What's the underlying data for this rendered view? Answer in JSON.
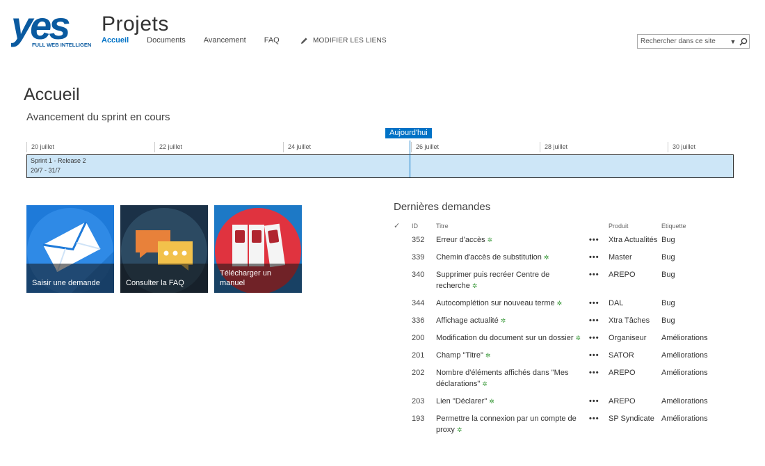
{
  "brand": {
    "logo_text": "yes",
    "logo_tagline": "FULL WEB INTELLIGENCE",
    "color": "#0a5aa0"
  },
  "site_title": "Projets",
  "nav": [
    {
      "label": "Accueil",
      "active": true
    },
    {
      "label": "Documents"
    },
    {
      "label": "Avancement"
    },
    {
      "label": "FAQ"
    }
  ],
  "edit_links": {
    "label": "MODIFIER LES LIENS",
    "icon": "pencil-icon"
  },
  "search": {
    "placeholder": "Rechercher dans ce site",
    "icon": "search-icon"
  },
  "page_title": "Accueil",
  "sprint": {
    "title": "Avancement du sprint en cours",
    "today_label": "Aujourd'hui",
    "dates": [
      "20 juillet",
      "22 juillet",
      "24 juillet",
      "26 juillet",
      "28 juillet",
      "30 juillet"
    ],
    "bar_name": "Sprint 1 - Release 2",
    "bar_range": "20/7 - 31/7"
  },
  "tiles": [
    {
      "label": "Saisir une demande",
      "icon": "envelope-icon",
      "color": "#1e7ad9"
    },
    {
      "label": "Consulter la FAQ",
      "icon": "chat-icon",
      "color": "#2c4a62"
    },
    {
      "label": "Télécharger un manuel",
      "icon": "binders-icon",
      "color": "#e0333f"
    }
  ],
  "requests": {
    "title": "Dernières demandes",
    "columns": {
      "check": "✓",
      "id": "ID",
      "title": "Titre",
      "product": "Produit",
      "tag": "Etiquette"
    },
    "rows": [
      {
        "id": "352",
        "title": "Erreur d'accès",
        "product": "Xtra Actualités",
        "tag": "Bug"
      },
      {
        "id": "339",
        "title": "Chemin d'accès de substitution",
        "product": "Master",
        "tag": "Bug"
      },
      {
        "id": "340",
        "title": "Supprimer puis recréer Centre de recherche",
        "product": "AREPO",
        "tag": "Bug"
      },
      {
        "id": "344",
        "title": "Autocomplétion sur nouveau terme",
        "product": "DAL",
        "tag": "Bug"
      },
      {
        "id": "336",
        "title": "Affichage actualité",
        "product": "Xtra Tâches",
        "tag": "Bug"
      },
      {
        "id": "200",
        "title": "Modification du document sur un dossier",
        "product": "Organiseur",
        "tag": "Améliorations"
      },
      {
        "id": "201",
        "title": "Champ \"Titre\"",
        "product": "SATOR",
        "tag": "Améliorations"
      },
      {
        "id": "202",
        "title": "Nombre d'éléments affichés dans \"Mes déclarations\"",
        "product": "AREPO",
        "tag": "Améliorations"
      },
      {
        "id": "203",
        "title": "Lien \"Déclarer\"",
        "product": "AREPO",
        "tag": "Améliorations"
      },
      {
        "id": "193",
        "title": "Permettre la connexion par un compte de proxy",
        "product": "SP Syndicate",
        "tag": "Améliorations"
      }
    ],
    "menu_glyph": "•••",
    "new_glyph": "✲"
  }
}
